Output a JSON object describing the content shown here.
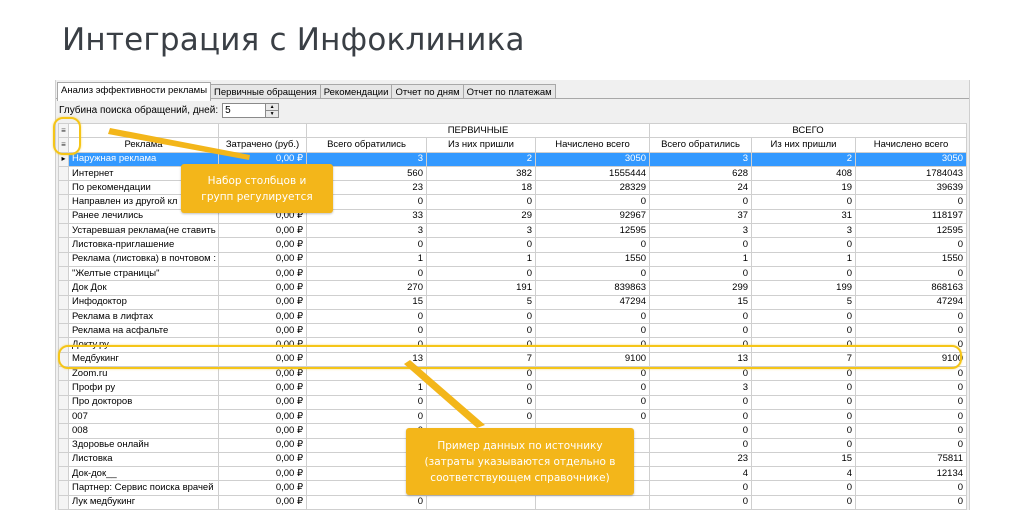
{
  "page_title": "Интеграция с Инфоклиника",
  "tabs": [
    {
      "label": "Анализ эффективности рекламы",
      "active": true
    },
    {
      "label": "Первичные обращения",
      "active": false
    },
    {
      "label": "Рекомендации",
      "active": false
    },
    {
      "label": "Отчет по дням",
      "active": false
    },
    {
      "label": "Отчет по платежам",
      "active": false
    }
  ],
  "depth": {
    "label": "Глубина поиска обращений, дней:",
    "value": "5"
  },
  "grid": {
    "group_headers": {
      "primary": "ПЕРВИЧНЫЕ",
      "total": "ВСЕГО"
    },
    "columns": [
      "Реклама",
      "Затрачено (руб.)",
      "Всего обратились",
      "Из них пришли",
      "Начислено всего",
      "Всего обратились",
      "Из них пришли",
      "Начислено всего"
    ],
    "rows": [
      {
        "name": "Наружная реклама",
        "spent": "0,00 ₽",
        "p_total": "3",
        "p_came": "2",
        "p_sum": "3050",
        "t_total": "3",
        "t_came": "2",
        "t_sum": "3050",
        "selected": true
      },
      {
        "name": "Интернет",
        "spent": "",
        "p_total": "560",
        "p_came": "382",
        "p_sum": "1555444",
        "t_total": "628",
        "t_came": "408",
        "t_sum": "1784043"
      },
      {
        "name": "По рекомендации",
        "spent": "",
        "p_total": "23",
        "p_came": "18",
        "p_sum": "28329",
        "t_total": "24",
        "t_came": "19",
        "t_sum": "39639"
      },
      {
        "name": "Направлен из другой кл",
        "spent": "",
        "p_total": "0",
        "p_came": "0",
        "p_sum": "0",
        "t_total": "0",
        "t_came": "0",
        "t_sum": "0"
      },
      {
        "name": "Ранее лечились",
        "spent": "0,00 ₽",
        "p_total": "33",
        "p_came": "29",
        "p_sum": "92967",
        "t_total": "37",
        "t_came": "31",
        "t_sum": "118197"
      },
      {
        "name": "Устаревшая реклама(не ставить",
        "spent": "0,00 ₽",
        "p_total": "3",
        "p_came": "3",
        "p_sum": "12595",
        "t_total": "3",
        "t_came": "3",
        "t_sum": "12595"
      },
      {
        "name": "Листовка-приглашение",
        "spent": "0,00 ₽",
        "p_total": "0",
        "p_came": "0",
        "p_sum": "0",
        "t_total": "0",
        "t_came": "0",
        "t_sum": "0"
      },
      {
        "name": "Реклама (листовка) в почтовом :",
        "spent": "0,00 ₽",
        "p_total": "1",
        "p_came": "1",
        "p_sum": "1550",
        "t_total": "1",
        "t_came": "1",
        "t_sum": "1550"
      },
      {
        "name": "\"Желтые страницы\"",
        "spent": "0,00 ₽",
        "p_total": "0",
        "p_came": "0",
        "p_sum": "0",
        "t_total": "0",
        "t_came": "0",
        "t_sum": "0"
      },
      {
        "name": "Док Док",
        "spent": "0,00 ₽",
        "p_total": "270",
        "p_came": "191",
        "p_sum": "839863",
        "t_total": "299",
        "t_came": "199",
        "t_sum": "868163"
      },
      {
        "name": "Инфодоктор",
        "spent": "0,00 ₽",
        "p_total": "15",
        "p_came": "5",
        "p_sum": "47294",
        "t_total": "15",
        "t_came": "5",
        "t_sum": "47294"
      },
      {
        "name": "Реклама в лифтах",
        "spent": "0,00 ₽",
        "p_total": "0",
        "p_came": "0",
        "p_sum": "0",
        "t_total": "0",
        "t_came": "0",
        "t_sum": "0"
      },
      {
        "name": "Реклама на асфальте",
        "spent": "0,00 ₽",
        "p_total": "0",
        "p_came": "0",
        "p_sum": "0",
        "t_total": "0",
        "t_came": "0",
        "t_sum": "0"
      },
      {
        "name": "Докту.ру",
        "spent": "0,00 ₽",
        "p_total": "0",
        "p_came": "0",
        "p_sum": "0",
        "t_total": "0",
        "t_came": "0",
        "t_sum": "0"
      },
      {
        "name": "Медбукинг",
        "spent": "0,00 ₽",
        "p_total": "13",
        "p_came": "7",
        "p_sum": "9100",
        "t_total": "13",
        "t_came": "7",
        "t_sum": "9100"
      },
      {
        "name": "Zoom.ru",
        "spent": "0,00 ₽",
        "p_total": "",
        "p_came": "0",
        "p_sum": "0",
        "t_total": "0",
        "t_came": "0",
        "t_sum": "0"
      },
      {
        "name": "Профи ру",
        "spent": "0,00 ₽",
        "p_total": "1",
        "p_came": "0",
        "p_sum": "0",
        "t_total": "3",
        "t_came": "0",
        "t_sum": "0"
      },
      {
        "name": "Про докторов",
        "spent": "0,00 ₽",
        "p_total": "0",
        "p_came": "0",
        "p_sum": "0",
        "t_total": "0",
        "t_came": "0",
        "t_sum": "0"
      },
      {
        "name": "007",
        "spent": "0,00 ₽",
        "p_total": "0",
        "p_came": "0",
        "p_sum": "0",
        "t_total": "0",
        "t_came": "0",
        "t_sum": "0"
      },
      {
        "name": "008",
        "spent": "0,00 ₽",
        "p_total": "0",
        "p_came": "",
        "p_sum": "",
        "t_total": "0",
        "t_came": "0",
        "t_sum": "0"
      },
      {
        "name": "Здоровье онлайн",
        "spent": "0,00 ₽",
        "p_total": "",
        "p_came": "",
        "p_sum": "",
        "t_total": "0",
        "t_came": "0",
        "t_sum": "0"
      },
      {
        "name": "Листовка",
        "spent": "0,00 ₽",
        "p_total": "",
        "p_came": "",
        "p_sum": "",
        "t_total": "23",
        "t_came": "15",
        "t_sum": "75811"
      },
      {
        "name": "Док-док__",
        "spent": "0,00 ₽",
        "p_total": "",
        "p_came": "",
        "p_sum": "",
        "t_total": "4",
        "t_came": "4",
        "t_sum": "12134"
      },
      {
        "name": "Партнер: Сервис поиска врачей",
        "spent": "0,00 ₽",
        "p_total": "",
        "p_came": "",
        "p_sum": "",
        "t_total": "0",
        "t_came": "0",
        "t_sum": "0"
      },
      {
        "name": "Лук медбукинг",
        "spent": "0,00 ₽",
        "p_total": "0",
        "p_came": "",
        "p_sum": "",
        "t_total": "0",
        "t_came": "0",
        "t_sum": "0"
      }
    ]
  },
  "callouts": {
    "columns_note": [
      "Набор столбцов и",
      "групп регулируется"
    ],
    "data_note": [
      "Пример данных по источнику",
      "(затраты указываются отдельно в",
      "соответствующем справочнике)"
    ]
  },
  "colors": {
    "accent": "#f3b61a",
    "selection": "#3399ff",
    "ring": "#f5c518"
  }
}
